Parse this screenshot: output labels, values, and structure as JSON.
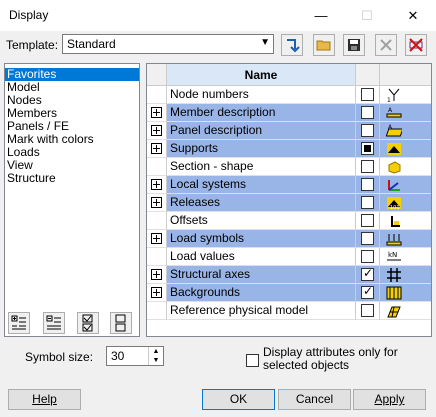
{
  "window": {
    "title": "Display"
  },
  "template": {
    "label": "Template:",
    "value": "Standard"
  },
  "left_items": [
    "Favorites",
    "Model",
    "Nodes",
    "Members",
    "Panels / FE",
    "Mark with colors",
    "Loads",
    "View",
    "Structure"
  ],
  "grid": {
    "header": "Name",
    "rows": [
      {
        "label": "Node numbers",
        "expand": false,
        "checked": "off",
        "highlight": false,
        "icon": "node-numbers-icon"
      },
      {
        "label": "Member description",
        "expand": true,
        "checked": "off",
        "highlight": true,
        "icon": "member-description-icon"
      },
      {
        "label": "Panel description",
        "expand": true,
        "checked": "off",
        "highlight": true,
        "icon": "panel-description-icon"
      },
      {
        "label": "Supports",
        "expand": true,
        "checked": "mixed",
        "highlight": true,
        "icon": "supports-icon"
      },
      {
        "label": "Section - shape",
        "expand": false,
        "checked": "off",
        "highlight": false,
        "icon": "section-shape-icon"
      },
      {
        "label": "Local systems",
        "expand": true,
        "checked": "off",
        "highlight": true,
        "icon": "local-systems-icon"
      },
      {
        "label": "Releases",
        "expand": true,
        "checked": "off",
        "highlight": true,
        "icon": "releases-icon"
      },
      {
        "label": "Offsets",
        "expand": false,
        "checked": "off",
        "highlight": false,
        "icon": "offsets-icon"
      },
      {
        "label": "Load symbols",
        "expand": true,
        "checked": "off",
        "highlight": true,
        "icon": "load-symbols-icon"
      },
      {
        "label": "Load values",
        "expand": false,
        "checked": "off",
        "highlight": false,
        "icon": "load-values-icon"
      },
      {
        "label": "Structural axes",
        "expand": true,
        "checked": "on",
        "highlight": true,
        "icon": "structural-axes-icon"
      },
      {
        "label": "Backgrounds",
        "expand": true,
        "checked": "on",
        "highlight": true,
        "icon": "backgrounds-icon"
      },
      {
        "label": "Reference physical model",
        "expand": false,
        "checked": "off",
        "highlight": false,
        "icon": "reference-physical-model-icon"
      }
    ]
  },
  "symbol_size": {
    "label": "Symbol size:",
    "value": "30"
  },
  "selected_only": {
    "label_line1": "Display attributes only for",
    "label_line2": "selected objects",
    "checked": false
  },
  "buttons": {
    "help": "Help",
    "ok": "OK",
    "cancel": "Cancel",
    "apply": "Apply"
  },
  "colors": {
    "highlight": "#99b4e6",
    "selection": "#0078d7",
    "header": "#d9e7f7"
  }
}
